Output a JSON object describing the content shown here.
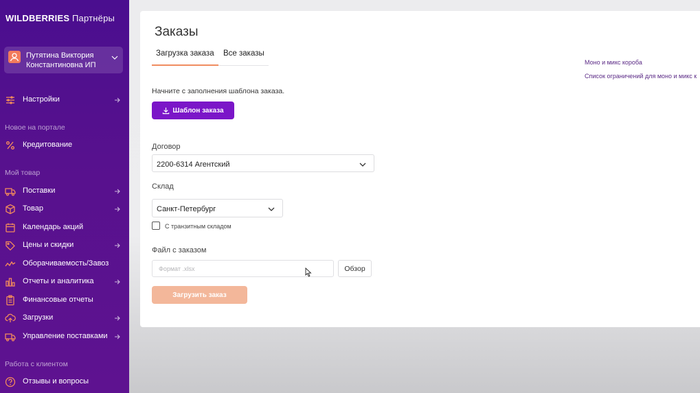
{
  "brand": {
    "name": "WILDBERRIES",
    "suffix": "Партнёры"
  },
  "profile": {
    "name": "Путятина Виктория Константиновна ИП",
    "avatar_icon": "user-icon"
  },
  "sidebar": {
    "settings": {
      "label": "Настройки",
      "icon": "sliders-icon"
    },
    "section_new": "Новое на портале",
    "crediting": {
      "label": "Кредитование",
      "icon": "percent-icon"
    },
    "section_goods": "Мой товар",
    "items": [
      {
        "label": "Поставки",
        "icon": "truck-icon"
      },
      {
        "label": "Товар",
        "icon": "box-icon"
      },
      {
        "label": "Календарь акций",
        "icon": "calendar-icon"
      },
      {
        "label": "Цены и скидки",
        "icon": "tag-icon"
      },
      {
        "label": "Оборачиваемость/Завоз",
        "icon": "trend-icon"
      },
      {
        "label": "Отчеты и аналитика",
        "icon": "bar-chart-icon"
      },
      {
        "label": "Финансовые отчеты",
        "icon": "clipboard-icon"
      },
      {
        "label": "Загрузки",
        "icon": "upload-cloud-icon"
      },
      {
        "label": "Управление поставками",
        "icon": "delivery-truck-icon"
      }
    ],
    "section_clients": "Работа с клиентом",
    "feedback": {
      "label": "Отзывы и вопросы",
      "icon": "question-icon"
    }
  },
  "main": {
    "title": "Заказы",
    "tabs": [
      {
        "label": "Загрузка заказа"
      },
      {
        "label": "Все заказы"
      }
    ],
    "links": [
      "Моно и микс короба",
      "Список ограничений для моно и микс к"
    ],
    "hint": "Начните с заполнения шаблона заказа.",
    "template_button": "Шаблон заказа",
    "contract_label": "Договор",
    "contract_value": "2200-6314 Агентский",
    "warehouse_label": "Склад",
    "warehouse_value": "Санкт-Петербург",
    "transit_label": "С транзитным складом",
    "file_label": "Файл с заказом",
    "file_placeholder": "Формат .xlsx",
    "browse_button": "Обзор",
    "upload_button": "Загрузить заказ"
  },
  "colors": {
    "sidebar": "#57118e",
    "primary": "#7b16c8",
    "upload_disabled": "#f3b79a",
    "tab_underline": "#f08c5f",
    "avatar": "#f27b5c"
  }
}
